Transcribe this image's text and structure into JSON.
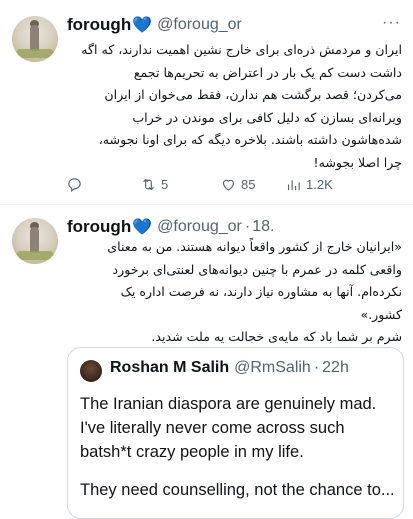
{
  "tweet1": {
    "display_name": "forough",
    "heart": "💙",
    "handle": "@foroug_or",
    "lines": [
      "ایران و مردمش ذره‌ای برای خارج نشین اهمیت ندارند، که اگه",
      "داشت دست کم یک بار در اعتراض به تحریم‌ها تجمع",
      "می‌کردن؛ قصد برگشت هم ندارن، فقط می‌خوان از ایران",
      "ویرانه‌ای بسازن که دلیل کافی برای موندن در خراب",
      "شده‌هاشون داشته باشند. بلاخره دیگه که برای اونا نجوشه،",
      "چرا اصلا بجوشه!"
    ],
    "actions": {
      "retweets": "5",
      "likes": "85",
      "views": "1.2K"
    }
  },
  "tweet2": {
    "display_name": "forough",
    "heart": "💙",
    "handle": "@foroug_or",
    "date": "18.",
    "lines": [
      "«ایرانیان خارج از کشور واقعاً دیوانه هستند. من به معنای",
      "واقعی کلمه در عمرم با چنین دیوانه‌های لعنتی‌ای برخورد",
      "نکرده‌ام. آنها به مشاوره نیاز دارند، نه فرصت اداره یک",
      "کشور.»",
      "شرم بر شما باد که مایه‌ی خجالت یه ملت شدید."
    ],
    "quote": {
      "display_name": "Roshan M Salih",
      "handle": "@RmSalih",
      "date": "22h",
      "lines": [
        "The Iranian diaspora are genuinely mad.",
        "I've literally never come across such",
        "batsh*t crazy people in my life."
      ],
      "last_line": "They need counselling, not the chance to..."
    }
  }
}
